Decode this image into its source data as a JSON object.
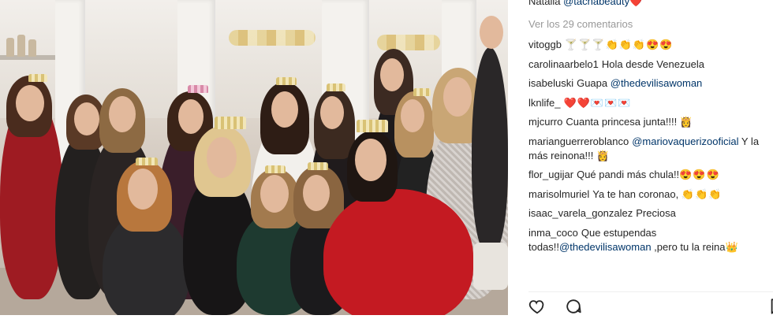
{
  "caption": {
    "prefix": "Natalia ",
    "mention": "@tachabeauty",
    "emoji": "❤️"
  },
  "view_all_comments": "Ver los 29 comentarios",
  "comments": [
    {
      "user": "vitoggb",
      "segments": [
        {
          "t": "emo",
          "v": "🍸🍸🍸👏👏👏😍😍"
        }
      ]
    },
    {
      "user": "carolinaarbelo1",
      "segments": [
        {
          "t": "text",
          "v": "Hola desde Venezuela"
        }
      ]
    },
    {
      "user": "isabeluski",
      "segments": [
        {
          "t": "text",
          "v": "Guapa "
        },
        {
          "t": "mention",
          "v": "@thedevilisawoman"
        }
      ]
    },
    {
      "user": "lknlife_",
      "segments": [
        {
          "t": "emo",
          "v": "❤️❤️💌💌💌"
        }
      ]
    },
    {
      "user": "mjcurro",
      "segments": [
        {
          "t": "text",
          "v": "Cuanta princesa junta!!!! "
        },
        {
          "t": "emo",
          "v": "👸"
        }
      ]
    },
    {
      "user": "marianguerreroblanco",
      "segments": [
        {
          "t": "mention",
          "v": "@mariovaquerizooficial"
        },
        {
          "t": "text",
          "v": " Y la más reinona!!! "
        },
        {
          "t": "emo",
          "v": "👸"
        }
      ]
    },
    {
      "user": "flor_ugijar",
      "segments": [
        {
          "t": "text",
          "v": "Qué pandi más chula!!"
        },
        {
          "t": "emo",
          "v": "😍😍😍"
        }
      ]
    },
    {
      "user": "marisolmuriel",
      "segments": [
        {
          "t": "text",
          "v": "Ya te han coronao, "
        },
        {
          "t": "emo",
          "v": "👏👏👏"
        }
      ]
    },
    {
      "user": "isaac_varela_gonzalez",
      "segments": [
        {
          "t": "text",
          "v": "Preciosa"
        }
      ]
    },
    {
      "user": "inma_coco",
      "segments": [
        {
          "t": "text",
          "v": "Que estupendas todas!!"
        },
        {
          "t": "mention",
          "v": "@thedevilisawoman"
        },
        {
          "t": "text",
          "v": " ,pero tu la reina"
        },
        {
          "t": "emo",
          "v": "👑"
        }
      ]
    }
  ],
  "icons": {
    "like": "heart-icon",
    "comment": "comment-icon",
    "save": "bookmark-icon"
  },
  "colors": {
    "mention": "#003569",
    "muted": "#999999",
    "text": "#262626"
  }
}
